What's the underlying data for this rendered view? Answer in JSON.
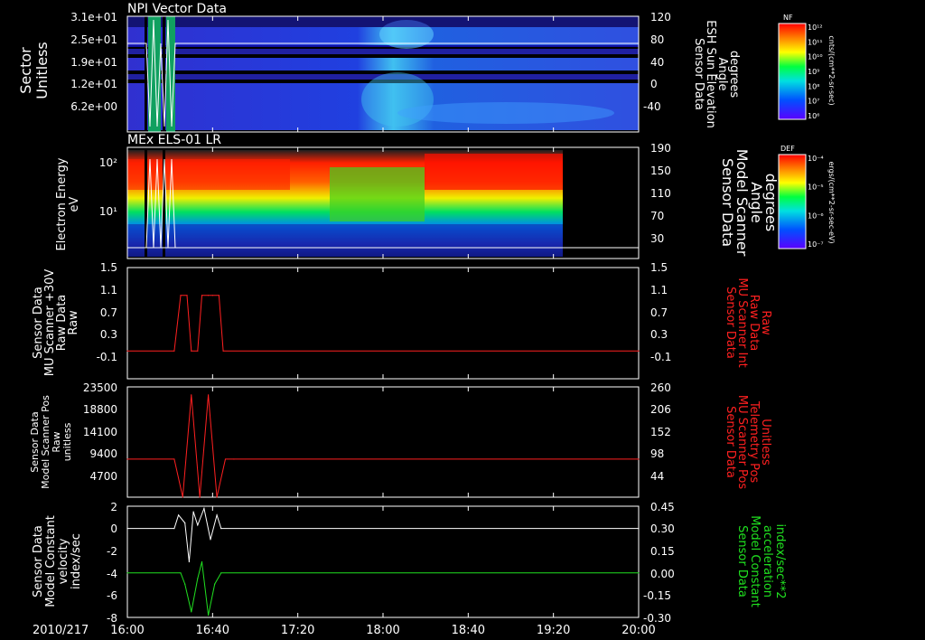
{
  "date_label": "2010/217",
  "time_ticks": [
    "16:00",
    "16:40",
    "17:20",
    "18:00",
    "18:40",
    "19:20",
    "20:00"
  ],
  "colors": {
    "red": "#ff2020",
    "green": "#20e020",
    "white": "#ffffff"
  },
  "chart_data": [
    {
      "type": "heatmap",
      "title": "NPI Vector Data",
      "ylabel_left": [
        "Sector",
        "Unitless"
      ],
      "yticks_left": [
        "3.1e+01",
        "2.5e+01",
        "1.9e+01",
        "1.2e+01",
        "6.2e+00"
      ],
      "ylabel_right": [
        "Sensor Data",
        "ESH Sun Elevation",
        "Angle",
        "degrees"
      ],
      "yticks_right": [
        "120",
        "80",
        "40",
        "0",
        "-40"
      ],
      "ylim_right": [
        -70,
        120
      ],
      "colorbar": {
        "label": "NF",
        "units": "cnts/(cm**2-sr-sec)",
        "ticks": [
          "10¹²",
          "10¹¹",
          "10¹⁰",
          "10⁹",
          "10⁸",
          "10⁷",
          "10⁶"
        ]
      }
    },
    {
      "type": "heatmap",
      "title": "MEx ELS-01 LR",
      "ylabel_left": [
        "Electron Energy",
        "eV"
      ],
      "yticks_left": [
        "10²",
        "10¹"
      ],
      "ylabel_right": [
        "Sensor Data",
        "Model Scanner",
        "Angle",
        "degrees"
      ],
      "yticks_right": [
        "190",
        "150",
        "110",
        "70",
        "30"
      ],
      "ylim_right": [
        0,
        190
      ],
      "colorbar": {
        "label": "DEF",
        "units": "ergs/(cm**2-sr-sec-eV)",
        "ticks": [
          "10⁻⁴",
          "10⁻⁵",
          "10⁻⁶",
          "10⁻⁷"
        ]
      }
    },
    {
      "type": "line",
      "ylabel_left": [
        "Sensor Data",
        "MU Scanner +30V",
        "Raw Data",
        "Raw"
      ],
      "yticks_left": [
        "1.5",
        "1.1",
        "0.7",
        "0.3",
        "-0.1"
      ],
      "ylim": [
        -0.5,
        1.5
      ],
      "ylabel_right": [
        "Sensor Data",
        "MU Scanner Int",
        "Raw Data",
        "Raw"
      ],
      "yticks_right": [
        "1.5",
        "1.1",
        "0.7",
        "0.3",
        "-0.1"
      ],
      "series": [
        {
          "x": [
            "16:00",
            "16:22",
            "16:25",
            "16:28",
            "16:30",
            "16:33",
            "16:35",
            "16:38",
            "16:40",
            "16:43",
            "16:45",
            "20:00"
          ],
          "values": [
            0,
            0,
            1,
            1,
            0,
            0,
            1,
            1,
            1,
            1,
            0,
            0
          ]
        }
      ]
    },
    {
      "type": "line",
      "ylabel_left": [
        "Sensor Data",
        "Model Scanner Pos",
        "Raw",
        "unitless"
      ],
      "yticks_left": [
        "23500",
        "18800",
        "14100",
        "9400",
        "4700"
      ],
      "ylim": [
        0,
        23500
      ],
      "ylabel_right": [
        "Sensor Data",
        "MU Scanner Pos",
        "Telemetry Pos",
        "Unitless"
      ],
      "yticks_right": [
        "260",
        "206",
        "152",
        "98",
        "44"
      ],
      "series": [
        {
          "x": [
            "16:00",
            "16:22",
            "16:26",
            "16:30",
            "16:34",
            "16:38",
            "16:42",
            "16:46",
            "16:50",
            "20:00"
          ],
          "values": [
            8100,
            8100,
            0,
            21800,
            0,
            21800,
            0,
            8100,
            8100,
            8100
          ]
        }
      ]
    },
    {
      "type": "line",
      "ylabel_left": [
        "Sensor Data",
        "Model Constant",
        "velocity",
        "index/sec"
      ],
      "yticks_left": [
        "2",
        "0",
        "-2",
        "-4",
        "-6",
        "-8"
      ],
      "ylim": [
        -8,
        2
      ],
      "ylabel_right": [
        "Sensor Data",
        "Model Constant",
        "acceleration",
        "index/sec**2"
      ],
      "yticks_right": [
        "0.45",
        "0.30",
        "0.15",
        "0.00",
        "-0.15",
        "-0.30"
      ],
      "series": [
        {
          "name": "",
          "color": "#ffffff",
          "x": [
            "16:00",
            "16:22",
            "16:24",
            "16:27",
            "16:29",
            "16:31",
            "16:33",
            "16:36",
            "16:39",
            "16:42",
            "16:44",
            "20:00"
          ],
          "values": [
            0,
            0,
            1.2,
            0.5,
            -3,
            1.5,
            0.3,
            1.8,
            -1,
            1.2,
            0,
            0
          ]
        },
        {
          "name": "",
          "color": "#20e020",
          "x": [
            "16:00",
            "16:25",
            "16:27",
            "16:30",
            "16:33",
            "16:35",
            "16:38",
            "16:41",
            "16:44",
            "20:00"
          ],
          "values": [
            -4,
            -4,
            -5,
            -7.5,
            -4.5,
            -3,
            -7.8,
            -5,
            -4,
            -4
          ]
        }
      ]
    }
  ]
}
